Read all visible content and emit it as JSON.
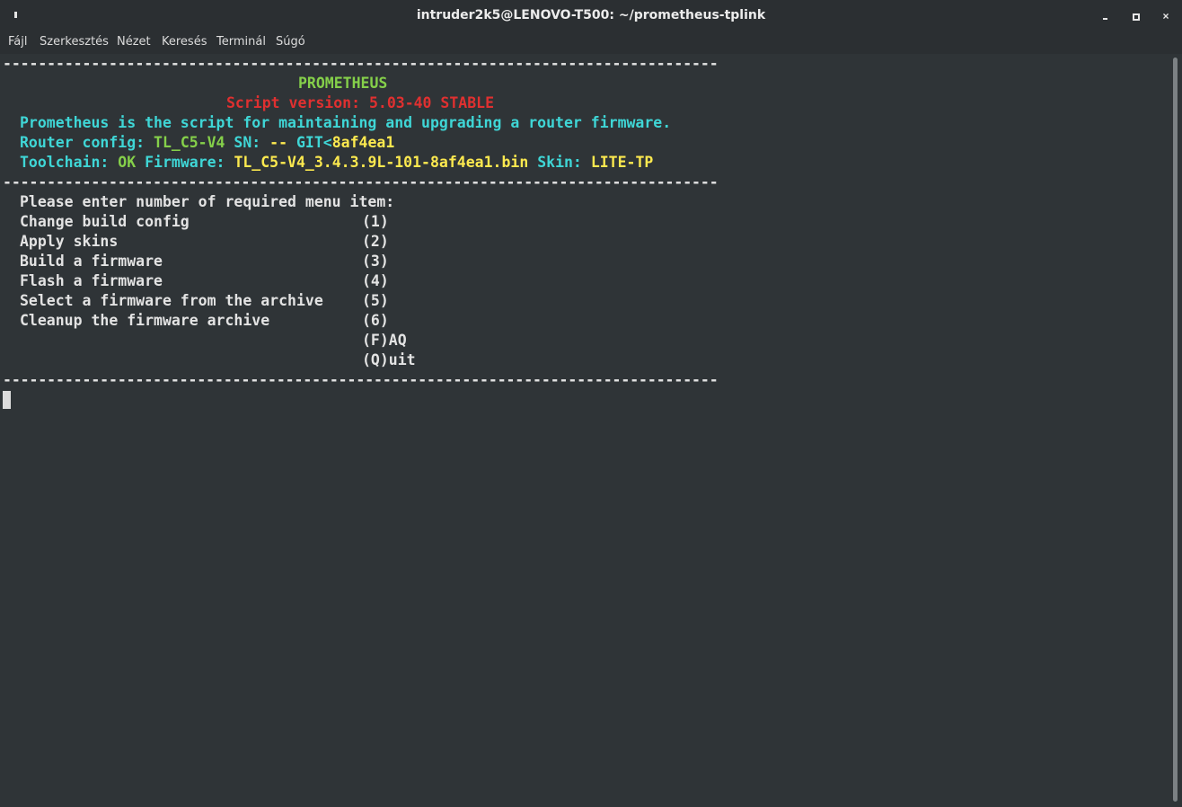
{
  "window": {
    "title": "intruder2k5@LENOVO-T500: ~/prometheus-tplink",
    "close_glyph": "×"
  },
  "menu": {
    "items": [
      "Fájl",
      "Szerkesztés",
      "Nézet",
      "Keresés",
      "Terminál",
      "Súgó"
    ]
  },
  "terminal": {
    "separator": "---------------------------------------------------------------------------------",
    "header": {
      "name": "PROMETHEUS",
      "version_label": "Script version: ",
      "version_value": "5.03-40 STABLE",
      "description": "Prometheus is the script for maintaining and upgrading a router firmware.",
      "router_config_label": "Router config: ",
      "router_config_value": "TL_C5-V4",
      "sn_label": " SN: ",
      "sn_value": "--",
      "git_label": " GIT<",
      "git_value": "8af4ea1",
      "toolchain_label": "Toolchain: ",
      "toolchain_value": "OK",
      "firmware_label": " Firmware: ",
      "firmware_value": "TL_C5-V4_3.4.3.9L-101-8af4ea1.bin",
      "skin_label": " Skin: ",
      "skin_value": "LITE-TP"
    },
    "prompt": "Please enter number of required menu item:",
    "options": [
      {
        "label": "Change build config",
        "key": "(1)"
      },
      {
        "label": "Apply skins",
        "key": "(2)"
      },
      {
        "label": "Build a firmware",
        "key": "(3)"
      },
      {
        "label": "Flash a firmware",
        "key": "(4)"
      },
      {
        "label": "Select a firmware from the archive",
        "key": "(5)"
      },
      {
        "label": "Cleanup the firmware archive",
        "key": "(6)"
      },
      {
        "label": "",
        "key": "(F)AQ"
      },
      {
        "label": "",
        "key": "(Q)uit"
      }
    ]
  },
  "colors": {
    "background": "#2f3437",
    "green": "#85d04a",
    "red": "#e03030",
    "cyan": "#3fd6d6",
    "yellow": "#fce94f"
  }
}
